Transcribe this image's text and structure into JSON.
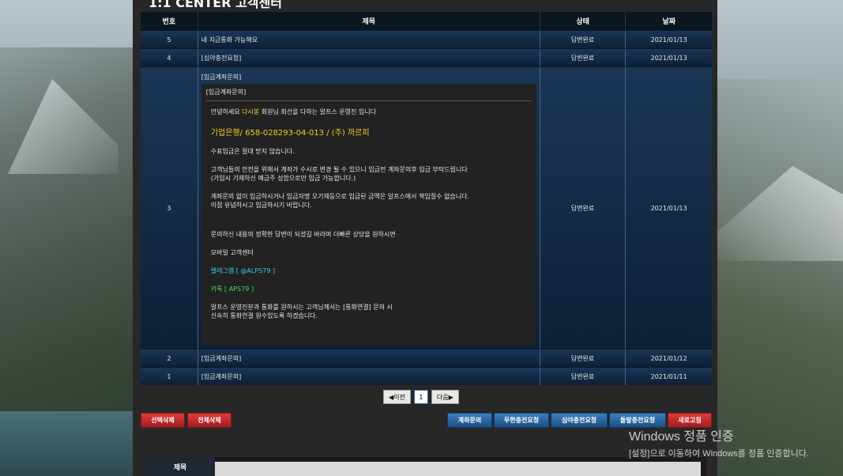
{
  "page": {
    "title": "1:1 CENTER 고객센터"
  },
  "table": {
    "headers": {
      "no": "번호",
      "subject": "제목",
      "status": "상태",
      "date": "날짜"
    },
    "rows": [
      {
        "no": "5",
        "subject": "네 지금통화 가능해요",
        "status": "답변완료",
        "date": "2021/01/13"
      },
      {
        "no": "4",
        "subject": "[심야충전요청]",
        "status": "답변완료",
        "date": "2021/01/13"
      },
      {
        "no": "3",
        "subject": "[입금계좌문의]",
        "status": "답변완료",
        "date": "2021/01/13"
      },
      {
        "no": "2",
        "subject": "[입금계좌문의]",
        "status": "답변완료",
        "date": "2021/01/12"
      },
      {
        "no": "1",
        "subject": "[입금계좌문의]",
        "status": "답변완료",
        "date": "2021/01/11"
      }
    ],
    "expanded": {
      "title": "[입금계좌문의]",
      "greeting_pre": "안녕하세요 ",
      "greeting_name": "다시봉",
      "greeting_post": " 회원님 최선을 다하는 알프스 운영진 입니다",
      "account": "기업은행/ 658-028293-04-013 / (주) 까르피",
      "line1": "수표입금은 절대 받지 않습니다.",
      "line2": "고객님들의 안전을 위해서 계좌가 수시로 변경 될 수 있으니 입금전 계좌문의후 입금 부탁드립니다",
      "line3": "(가입시 기재하신 예금주 성함으로만 입금 가능합니다.)",
      "line4": "계좌문의 없이 입금하시거나 입금자명 오기재등으로 입금된 금액은 알프스에서 책임질수 없습니다.",
      "line5": "이점 유념하시고 입금하시기 바랍니다.",
      "line6": "문의하신 내용의 정확한 답변이 되셨길 바라며 더빠른 상담을 원하시면",
      "line7": "모바일 고객센터",
      "telegram": "텔레그램 [ @ALPS79 ]",
      "kakao": "카톡 [ APS79 ]",
      "line8": "알프스 운영진분과 통화를 원하시는 고객님께서는 [통화연결] 문의 시",
      "line9": "신속히 통화연결 원수있도록 하겠습니다."
    }
  },
  "pager": {
    "prev": "◀이전",
    "page": "1",
    "next": "다음▶"
  },
  "actions": {
    "delete_selected": "선택삭제",
    "delete_all": "전체삭제",
    "account_inquiry": "계좌문의",
    "unlimited_charge": "무한충전요청",
    "night_charge": "심야충전요청",
    "sudden_charge": "돌발충전요청",
    "refresh": "새로고침"
  },
  "form": {
    "subject_label": "제목"
  },
  "watermark": {
    "line1": "Windows 정품 인증",
    "line2": "[설정]으로 이동하여 Windows를 정품 인증합니다."
  }
}
